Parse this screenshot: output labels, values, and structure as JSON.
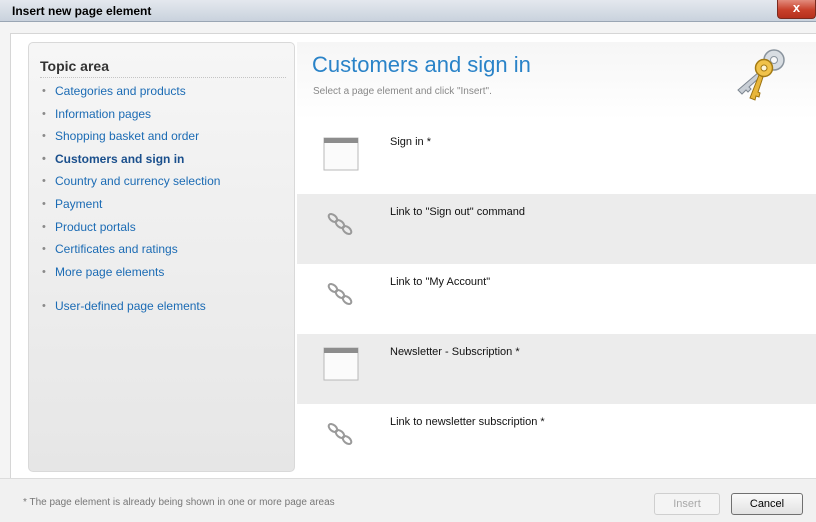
{
  "window": {
    "title": "Insert new page element",
    "close_glyph": "x"
  },
  "sidebar": {
    "title": "Topic area",
    "items": [
      {
        "label": "Categories and products",
        "active": false
      },
      {
        "label": "Information pages",
        "active": false
      },
      {
        "label": "Shopping basket and order",
        "active": false
      },
      {
        "label": "Customers and sign in",
        "active": true
      },
      {
        "label": "Country and currency selection",
        "active": false
      },
      {
        "label": "Payment",
        "active": false
      },
      {
        "label": "Product portals",
        "active": false
      },
      {
        "label": "Certificates and ratings",
        "active": false
      },
      {
        "label": "More page elements",
        "active": false
      },
      {
        "label": "User-defined page elements",
        "active": false
      }
    ]
  },
  "main": {
    "title": "Customers and sign in",
    "subtitle": "Select a page element and click \"Insert\".",
    "header_icon": "keys-icon",
    "elements": [
      {
        "label": "Sign in *",
        "icon": "page-element-icon"
      },
      {
        "label": "Link to \"Sign out\" command",
        "icon": "link-icon"
      },
      {
        "label": "Link to \"My Account\"",
        "icon": "link-icon"
      },
      {
        "label": "Newsletter - Subscription *",
        "icon": "page-element-icon"
      },
      {
        "label": "Link to newsletter subscription *",
        "icon": "link-icon"
      }
    ]
  },
  "footer": {
    "note": "* The page element is already being shown in one or more page areas",
    "insert_label": "Insert",
    "cancel_label": "Cancel"
  },
  "colors": {
    "accent": "#2a83c8",
    "link": "#1b6bb4",
    "row_alt": "#ececec"
  }
}
